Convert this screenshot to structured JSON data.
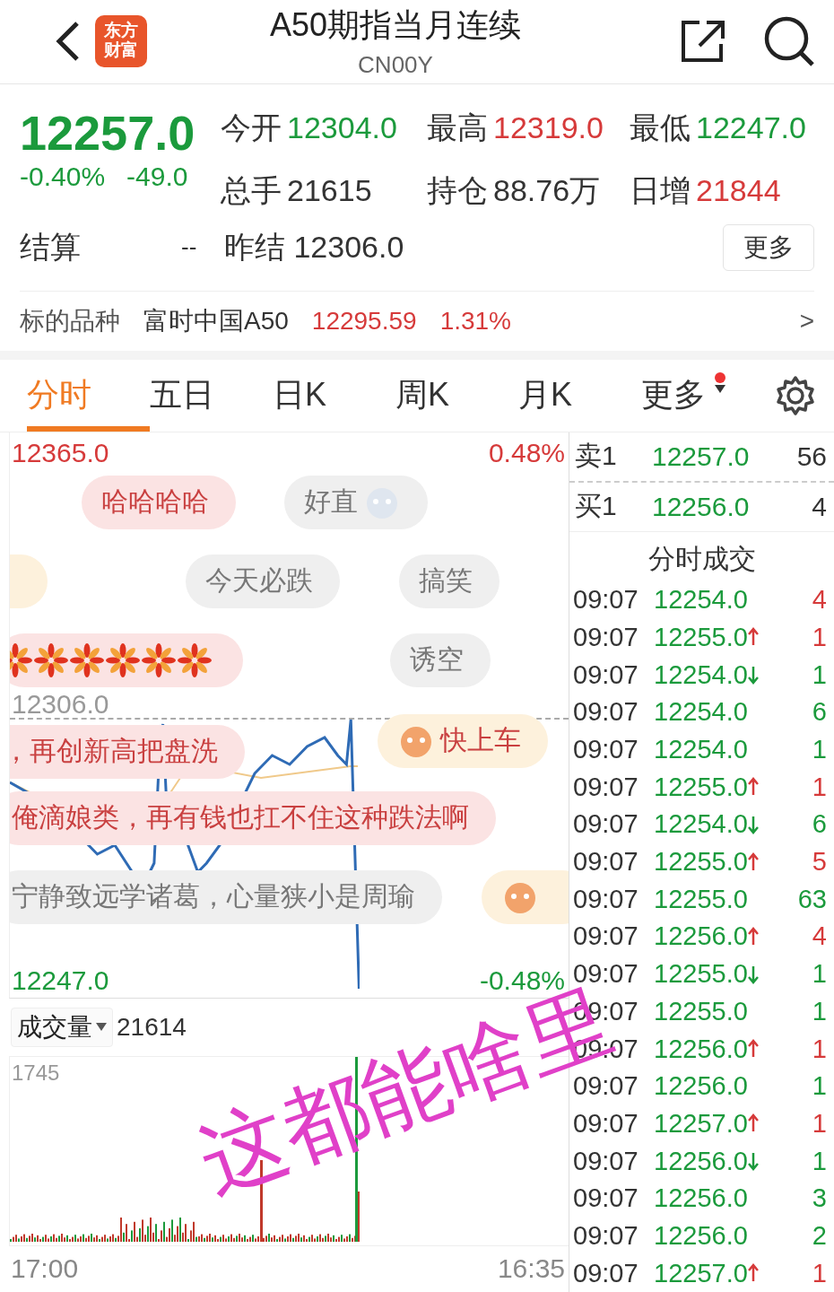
{
  "header": {
    "logo": "东方财富",
    "title": "A50期指当月连续",
    "code": "CN00Y"
  },
  "quote": {
    "price": "12257.0",
    "change_pct": "-0.40%",
    "change": "-49.0",
    "color": "#1b9a3c",
    "fields": [
      {
        "label": "今开",
        "value": "12304.0",
        "color": "#1b9a3c"
      },
      {
        "label": "最高",
        "value": "12319.0",
        "color": "#d63a3a"
      },
      {
        "label": "最低",
        "value": "12247.0",
        "color": "#1b9a3c"
      },
      {
        "label": "总手",
        "value": "21615",
        "color": "#333333"
      },
      {
        "label": "持仓",
        "value": "88.76万",
        "color": "#333333"
      },
      {
        "label": "日增",
        "value": "21844",
        "color": "#d63a3a"
      }
    ],
    "settle_label": "结算",
    "settle_value": "--",
    "prev_label": "昨结",
    "prev_value": "12306.0",
    "more_button": "更多"
  },
  "underlying": {
    "label": "标的品种",
    "name": "富时中国A50",
    "price": "12295.59",
    "pct": "1.31%",
    "arrow": ">"
  },
  "tabs": [
    {
      "label": "分时",
      "selected": true
    },
    {
      "label": "五日",
      "selected": false
    },
    {
      "label": "日K",
      "selected": false
    },
    {
      "label": "周K",
      "selected": false
    },
    {
      "label": "月K",
      "selected": false
    },
    {
      "label": "更多",
      "selected": false,
      "badge": true
    }
  ],
  "chart": {
    "high": "12365.0",
    "high_pct": "0.48%",
    "prev_close": "12306.0",
    "low": "12247.0",
    "low_pct": "-0.48%",
    "volume_label": "成交量",
    "volume": "21614",
    "volume_max": "1745",
    "time_start": "17:00",
    "time_end": "16:35"
  },
  "danmaku": [
    {
      "text": "哈哈哈哈",
      "color": "#fbe3e3",
      "emoji": false
    },
    {
      "text": "好直",
      "color": "#efefef",
      "emoji": true
    },
    {
      "color": "#fdf1dc",
      "emoji": false
    },
    {
      "text": "今天必跌",
      "color": "#efefef",
      "emoji": false
    },
    {
      "text": "搞笑",
      "color": "#efefef",
      "emoji": false
    },
    {
      "text": "诱空",
      "color": "#efefef",
      "emoji": false
    },
    {
      "text": "，再创新高把盘洗",
      "color": "#fbe3e3",
      "emoji": false
    },
    {
      "text": "快上车",
      "color": "#fdf1dc",
      "emoji": true
    },
    {
      "text": "俺滴娘类，再有钱也扛不住这种跌法啊",
      "color": "#fbe3e3",
      "emoji": false
    },
    {
      "text": "宁静致远学诸葛，心量狭小是周瑜",
      "color": "#efefef",
      "emoji": false
    },
    {
      "color": "#fdf1dc",
      "emoji": true
    }
  ],
  "order_book": [
    {
      "label": "卖1",
      "price": "12257.0",
      "volume": "56"
    },
    {
      "label": "买1",
      "price": "12256.0",
      "volume": "4"
    }
  ],
  "trades_title": "分时成交",
  "trades": [
    {
      "time": "09:07",
      "price": "12254.0",
      "kind": "plain",
      "volume": "4",
      "color": "#d63a3a"
    },
    {
      "time": "09:07",
      "price": "12255.0",
      "kind": "up",
      "volume": "1",
      "color": "#d63a3a"
    },
    {
      "time": "09:07",
      "price": "12254.0",
      "kind": "down",
      "volume": "1",
      "color": "#1b9a3c"
    },
    {
      "time": "09:07",
      "price": "12254.0",
      "kind": "plain",
      "volume": "6",
      "color": "#1b9a3c"
    },
    {
      "time": "09:07",
      "price": "12254.0",
      "kind": "plain",
      "volume": "1",
      "color": "#1b9a3c"
    },
    {
      "time": "09:07",
      "price": "12255.0",
      "kind": "up",
      "volume": "1",
      "color": "#d63a3a"
    },
    {
      "time": "09:07",
      "price": "12254.0",
      "kind": "down",
      "volume": "6",
      "color": "#1b9a3c"
    },
    {
      "time": "09:07",
      "price": "12255.0",
      "kind": "up",
      "volume": "5",
      "color": "#d63a3a"
    },
    {
      "time": "09:07",
      "price": "12255.0",
      "kind": "plain",
      "volume": "63",
      "color": "#1b9a3c"
    },
    {
      "time": "09:07",
      "price": "12256.0",
      "kind": "up",
      "volume": "4",
      "color": "#d63a3a"
    },
    {
      "time": "09:07",
      "price": "12255.0",
      "kind": "down",
      "volume": "1",
      "color": "#1b9a3c"
    },
    {
      "time": "09:07",
      "price": "12255.0",
      "kind": "plain",
      "volume": "1",
      "color": "#1b9a3c"
    },
    {
      "time": "09:07",
      "price": "12256.0",
      "kind": "up",
      "volume": "1",
      "color": "#d63a3a"
    },
    {
      "time": "09:07",
      "price": "12256.0",
      "kind": "plain",
      "volume": "1",
      "color": "#1b9a3c"
    },
    {
      "time": "09:07",
      "price": "12257.0",
      "kind": "up",
      "volume": "1",
      "color": "#d63a3a"
    },
    {
      "time": "09:07",
      "price": "12256.0",
      "kind": "down",
      "volume": "1",
      "color": "#1b9a3c"
    },
    {
      "time": "09:07",
      "price": "12256.0",
      "kind": "plain",
      "volume": "3",
      "color": "#1b9a3c"
    },
    {
      "time": "09:07",
      "price": "12256.0",
      "kind": "plain",
      "volume": "2",
      "color": "#1b9a3c"
    },
    {
      "time": "09:07",
      "price": "12257.0",
      "kind": "up",
      "volume": "1",
      "color": "#d63a3a"
    }
  ],
  "annotation": "这都能啥里"
}
